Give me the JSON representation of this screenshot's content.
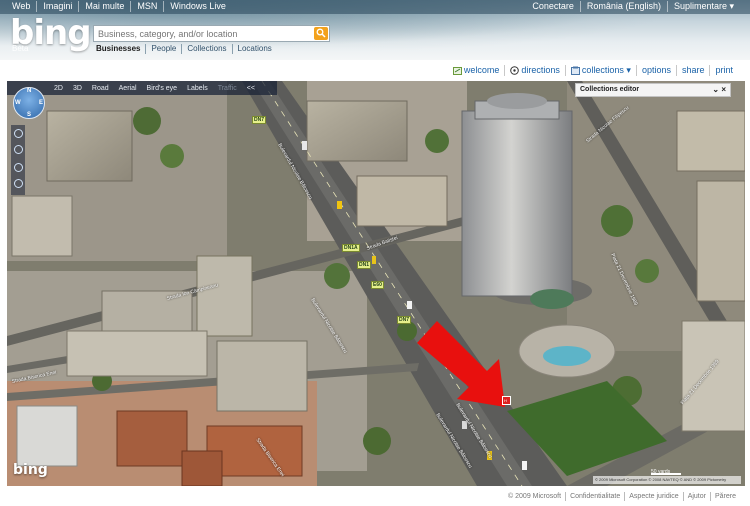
{
  "top_nav": {
    "left": [
      "Web",
      "Imagini",
      "Mai multe",
      "MSN",
      "Windows Live"
    ],
    "right": [
      "Conectare",
      "România (English)",
      "Suplimentare ▾"
    ]
  },
  "brand": {
    "logo": "bing",
    "beta": "Beta"
  },
  "search": {
    "placeholder": "Business, category, and/or location",
    "scopes": [
      "Businesses",
      "People",
      "Collections",
      "Locations"
    ]
  },
  "toolbar": {
    "links": [
      "welcome",
      "directions",
      "collections ▾",
      "options",
      "share",
      "print"
    ]
  },
  "map": {
    "view_buttons": [
      "2D",
      "3D",
      "Road",
      "Aerial",
      "Bird's eye",
      "Labels",
      "Traffic",
      "<<"
    ],
    "compass": {
      "n": "N",
      "s": "S",
      "e": "E",
      "w": "W"
    },
    "collections_editor": {
      "title": "Collections editor",
      "controls": "⌄ ×"
    },
    "logo": "bing",
    "road_labels": [
      "Bulevardul Nicolae Bălcescu",
      "Strada Ion Câmpineanu",
      "Strada Batiștei",
      "Strada Biserica Enei",
      "Strada Biserica Enei",
      "Piața 21 Decembrie 1989",
      "Piața 21 Decembrie 1989",
      "Bulevardul Nicolae Bălcescu",
      "Bulevardul Nicolae Bălcescu",
      "Bulevardul Nicolae Bălcescu",
      "Strada Nicolae Filipescu"
    ],
    "route_shields": [
      "DN7",
      "DN1A",
      "DN1",
      "E60",
      "DN7"
    ],
    "pin_label": "H",
    "scale": "50 yards",
    "attribution": "© 2009 Microsoft Corporation  © 2008 NAVTEQ  © AND  © 2009 Pictometry"
  },
  "footer": [
    "© 2009 Microsoft",
    "Confidentialitate",
    "Aspecte juridice",
    "Ajutor",
    "Părere"
  ],
  "colors": {
    "link": "#1a62a8",
    "arrow": "#e8100e",
    "search_button": "#f3a21c"
  }
}
